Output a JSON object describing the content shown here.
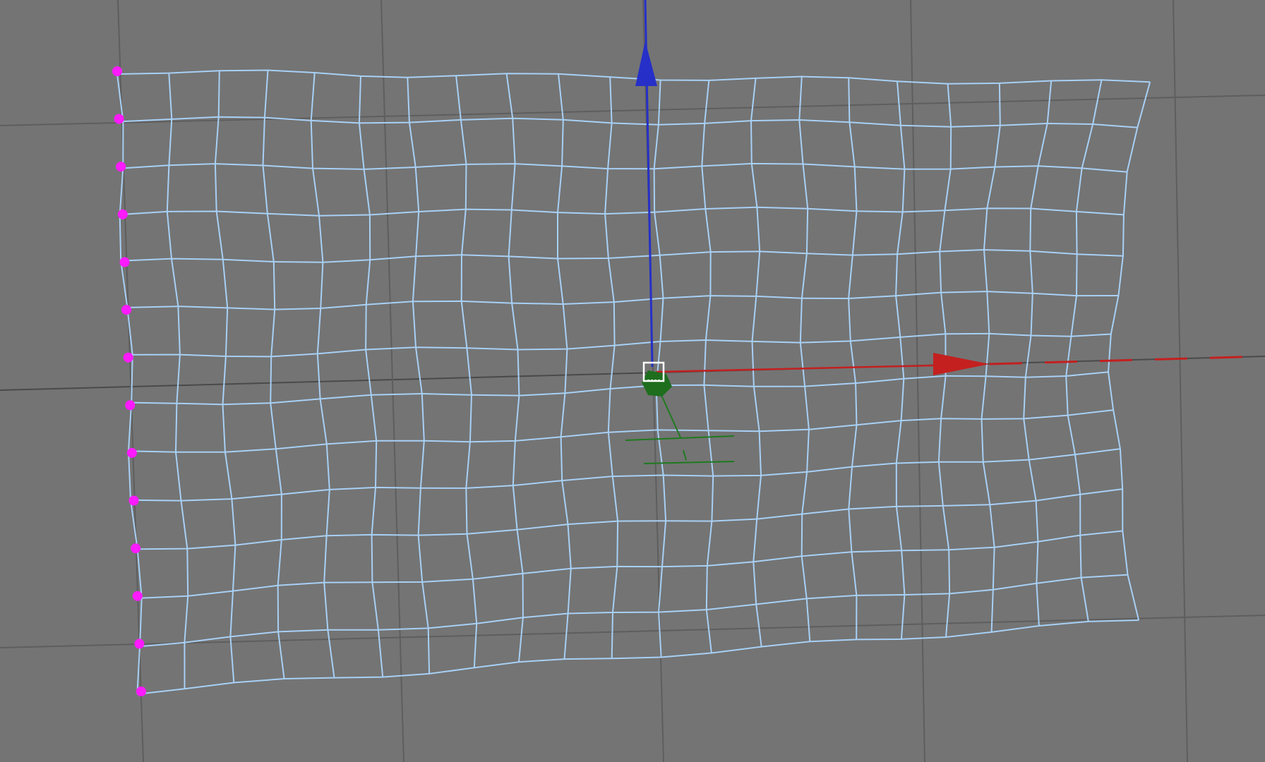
{
  "viewport": {
    "name": "3D viewport",
    "background_color": "#747474",
    "scene_grid_color": "#5e5e5e",
    "scene_axis_line_color": "#4a4a4a"
  },
  "mesh": {
    "wire_color": "#a8d0f5",
    "selected_vertex_color": "#ff1aff",
    "selected_vertex_count": 14
  },
  "gizmo": {
    "z_axis_color": "#2630c8",
    "x_axis_color": "#c42020",
    "y_axis_color": "#1f7a1f",
    "center_box_color": "#ffffff",
    "pivot_color": "#1e6e1e"
  }
}
